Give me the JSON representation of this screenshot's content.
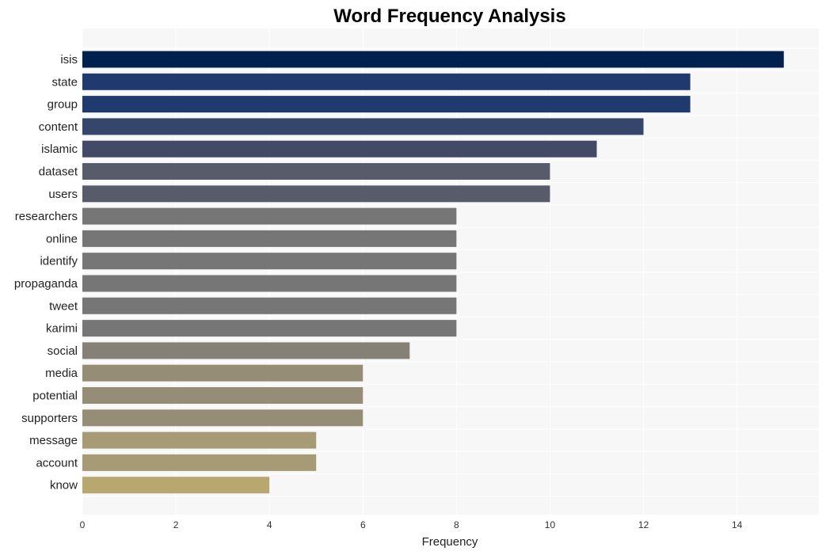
{
  "chart_data": {
    "type": "bar",
    "orientation": "horizontal",
    "title": "Word Frequency Analysis",
    "xlabel": "Frequency",
    "ylabel": "",
    "xlim": [
      0,
      15.75
    ],
    "xticks": [
      0,
      2,
      4,
      6,
      8,
      10,
      12,
      14
    ],
    "grid": true,
    "categories": [
      "isis",
      "state",
      "group",
      "content",
      "islamic",
      "dataset",
      "users",
      "researchers",
      "online",
      "identify",
      "propaganda",
      "tweet",
      "karimi",
      "social",
      "media",
      "potential",
      "supporters",
      "message",
      "account",
      "know"
    ],
    "values": [
      15,
      13,
      13,
      12,
      11,
      10,
      10,
      8,
      8,
      8,
      8,
      8,
      8,
      7,
      6,
      6,
      6,
      5,
      5,
      4
    ],
    "colors": [
      "#00204e",
      "#1f3a6f",
      "#1f3a6f",
      "#35456c",
      "#424a68",
      "#585b6a",
      "#585b6a",
      "#767676",
      "#767676",
      "#767676",
      "#767676",
      "#767676",
      "#767676",
      "#858176",
      "#958d75",
      "#958d75",
      "#958d75",
      "#a69b74",
      "#a69b74",
      "#b8a76e"
    ]
  }
}
